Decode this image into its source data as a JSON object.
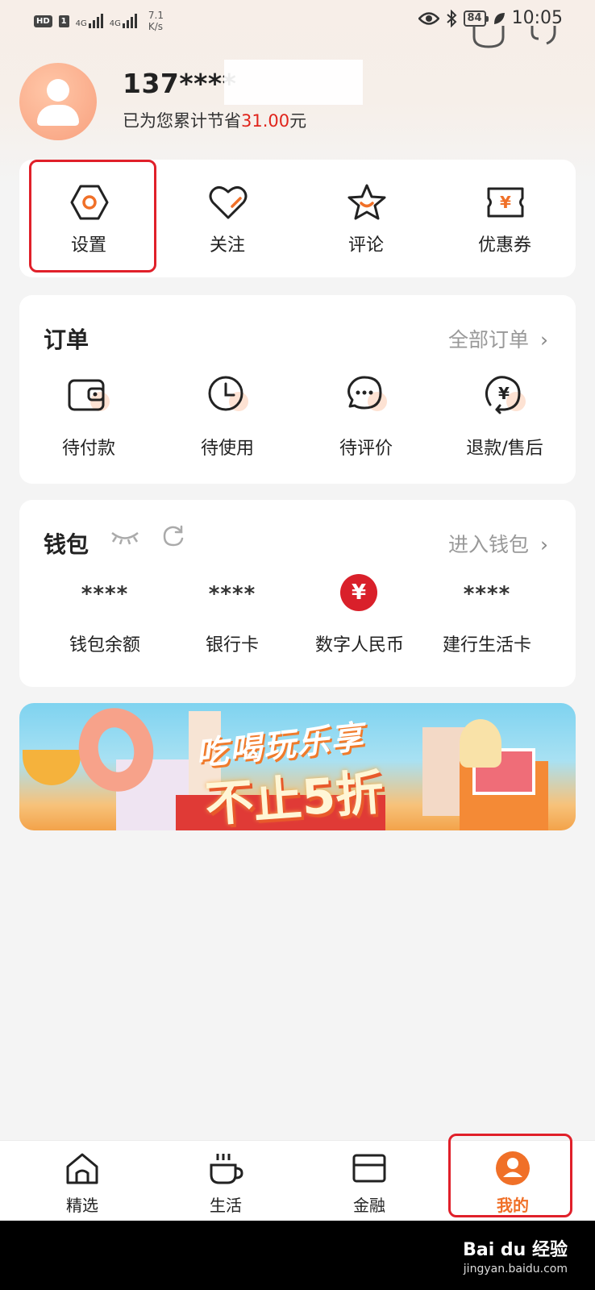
{
  "status_bar": {
    "hd": "HD",
    "sim": "1",
    "net1": "4G",
    "net2": "4G",
    "speed_value": "7.1",
    "speed_unit": "K/s",
    "battery": "84",
    "time": "10:05"
  },
  "profile": {
    "phone": "137****",
    "saved_prefix": "已为您累计节省",
    "saved_amount": "31.00",
    "saved_suffix": "元"
  },
  "quick_actions": [
    {
      "label": "设置",
      "icon": "settings-icon",
      "highlighted": true
    },
    {
      "label": "关注",
      "icon": "heart-icon"
    },
    {
      "label": "评论",
      "icon": "star-icon"
    },
    {
      "label": "优惠券",
      "icon": "coupon-icon"
    }
  ],
  "orders": {
    "title": "订单",
    "link": "全部订单",
    "items": [
      {
        "label": "待付款",
        "icon": "wallet-icon"
      },
      {
        "label": "待使用",
        "icon": "clock-icon"
      },
      {
        "label": "待评价",
        "icon": "chat-icon"
      },
      {
        "label": "退款/售后",
        "icon": "refund-icon"
      }
    ]
  },
  "wallet": {
    "title": "钱包",
    "link": "进入钱包",
    "items": [
      {
        "value": "****",
        "label": "钱包余额"
      },
      {
        "value": "****",
        "label": "银行卡"
      },
      {
        "value": "¥",
        "label": "数字人民币"
      },
      {
        "value": "****",
        "label": "建行生活卡"
      }
    ]
  },
  "banner": {
    "line1": "吃喝玩乐享",
    "line2": "不止5折"
  },
  "bottom_nav": [
    {
      "label": "精选",
      "icon": "home-icon"
    },
    {
      "label": "生活",
      "icon": "cup-icon"
    },
    {
      "label": "金融",
      "icon": "card-icon"
    },
    {
      "label": "我的",
      "icon": "profile-icon",
      "active": true
    }
  ],
  "colors": {
    "accent": "#f07028",
    "highlight": "#e0202a",
    "amount": "#e0241b"
  },
  "watermark": {
    "brand": "Bai du 经验",
    "url": "jingyan.baidu.com"
  }
}
